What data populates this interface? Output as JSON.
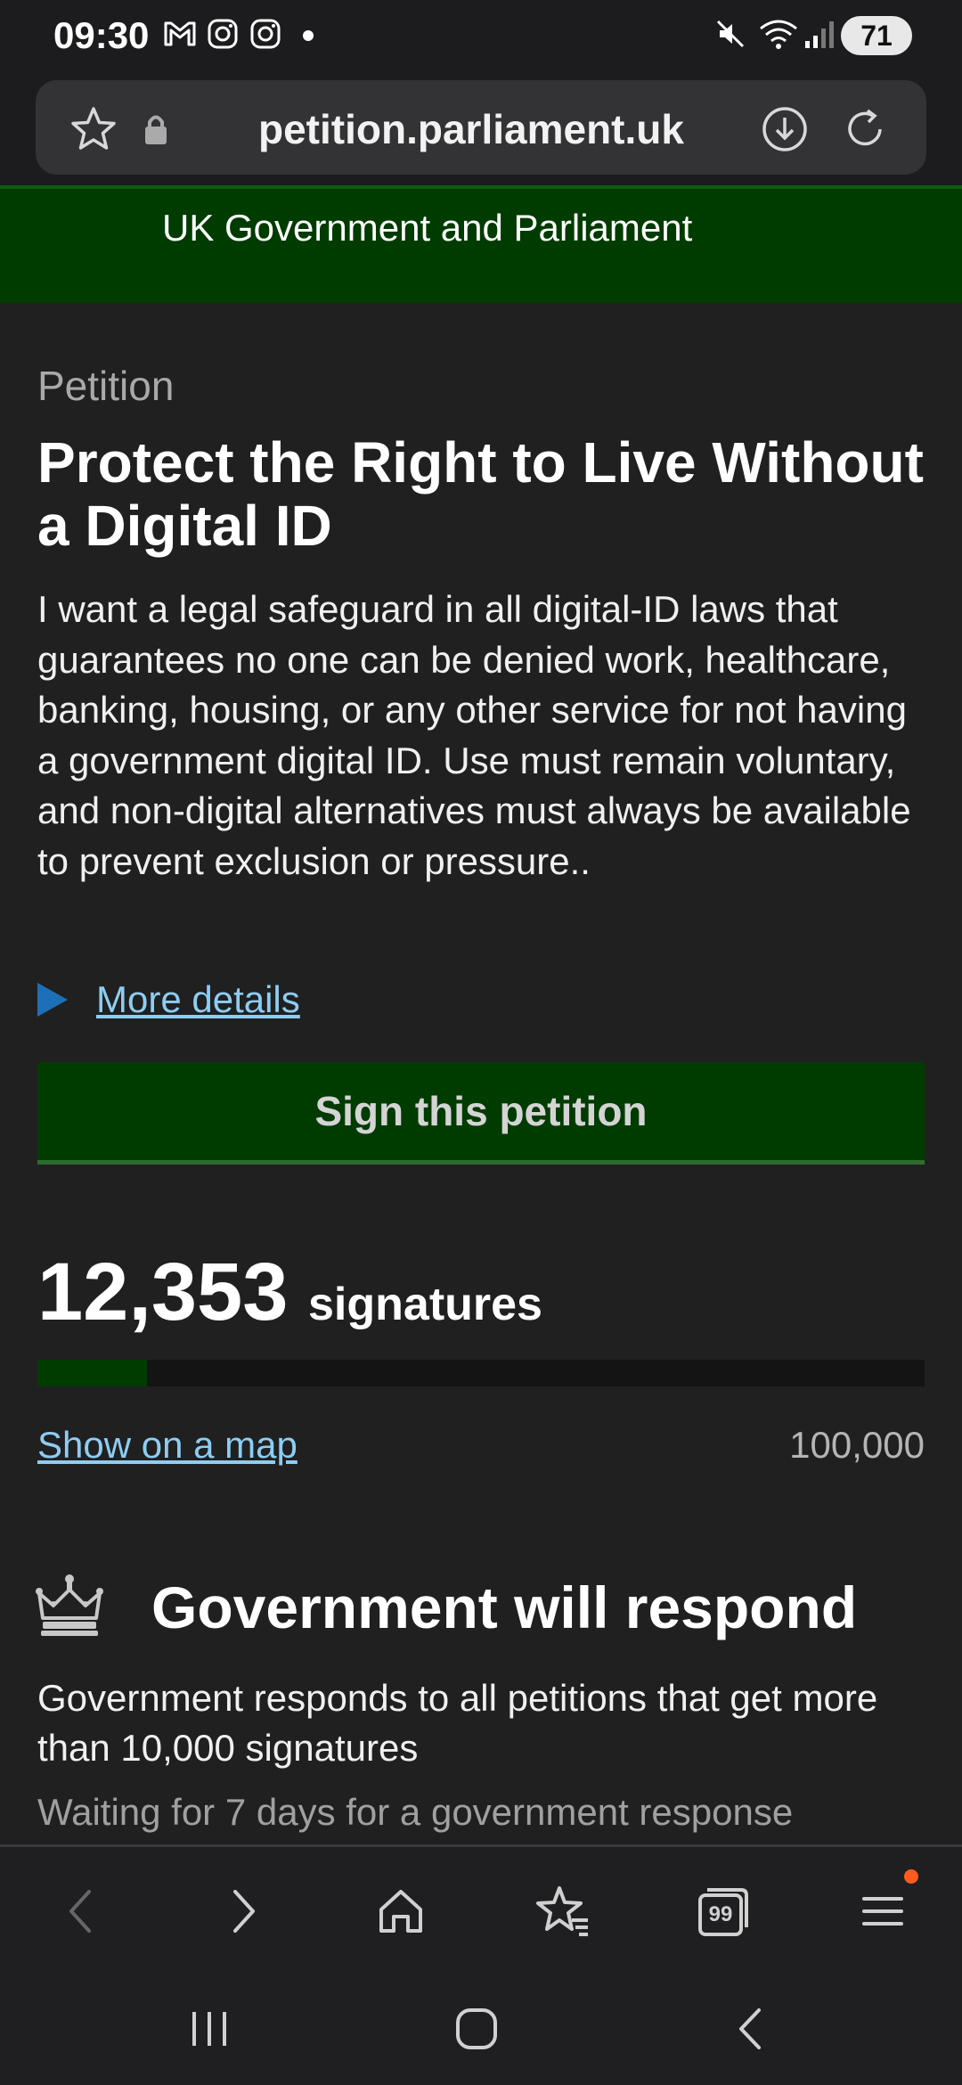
{
  "status_bar": {
    "time": "09:30",
    "left_icons": [
      "gmail-icon",
      "instagram-icon",
      "instagram-icon",
      "dot-icon"
    ],
    "right_icons": [
      "mute-icon",
      "wifi-icon",
      "signal-icon"
    ],
    "battery": "71"
  },
  "browser": {
    "url": "petition.parliament.uk",
    "icons": [
      "star-icon",
      "lock-icon",
      "download-icon",
      "reload-icon"
    ]
  },
  "site_header": {
    "title": "UK Government and Parliament"
  },
  "petition": {
    "label": "Petition",
    "title": "Protect the Right to Live Without a Digital ID",
    "body": "I want a legal safeguard in all digital-ID laws that guarantees no one can be denied work, healthcare, banking, housing, or any other service for not having a government digital ID. Use must remain voluntary, and non-digital alternatives must always be available to prevent exclusion or pressure..",
    "more_details": "More details",
    "sign_button": "Sign this petition"
  },
  "signatures": {
    "count": "12,353",
    "word": "signatures",
    "progress_fraction": 0.1235,
    "map_link": "Show on a map",
    "goal": "100,000"
  },
  "response": {
    "heading": "Government will respond",
    "text": "Government responds to all petitions that get more than 10,000 signatures",
    "waiting": "Waiting for 7 days for a government response"
  },
  "bottom_bar": {
    "icons": [
      "back-icon",
      "forward-icon",
      "home-icon",
      "bookmarks-icon",
      "tabs-icon",
      "menu-icon"
    ],
    "tabs_count": "99"
  },
  "system_nav": {
    "icons": [
      "recents-icon",
      "home-circle-icon",
      "system-back-icon"
    ]
  },
  "colors": {
    "header_green": "#003b00",
    "link_blue": "#8ecdf2",
    "triangle_blue": "#1d70b8",
    "background": "#202021",
    "notification_dot": "#ff5a1f"
  }
}
